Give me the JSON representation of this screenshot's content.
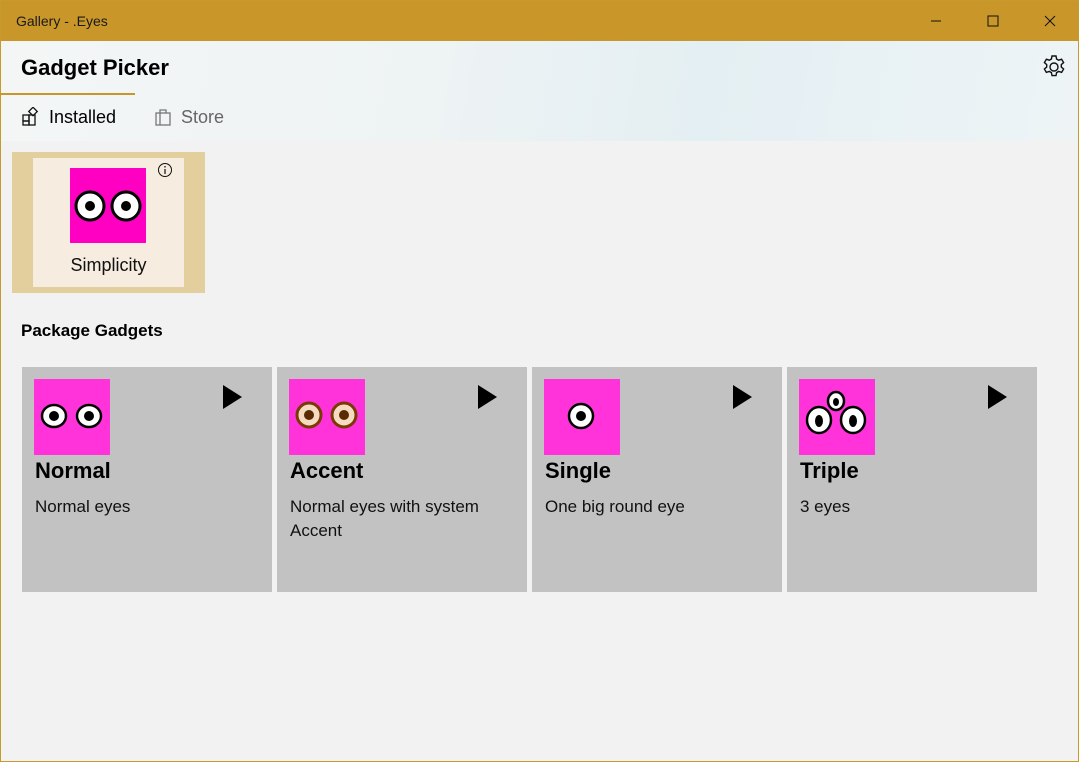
{
  "window": {
    "title": "Gallery - .Eyes",
    "accent_color": "#c9962a"
  },
  "header": {
    "title": "Gadget Picker",
    "settings_icon": "gear-icon",
    "tabs": [
      {
        "label": "Installed",
        "icon": "installed-icon",
        "selected": true
      },
      {
        "label": "Store",
        "icon": "store-bag-icon",
        "selected": false
      }
    ]
  },
  "installed": {
    "items": [
      {
        "label": "Simplicity",
        "thumb_color": "#ff00c3"
      }
    ]
  },
  "package": {
    "section_title": "Package Gadgets",
    "gadgets": [
      {
        "name": "Normal",
        "description": "Normal eyes",
        "thumb_color": "#ff33d9"
      },
      {
        "name": "Accent",
        "description": "Normal eyes with system Accent",
        "thumb_color": "#ff33d9"
      },
      {
        "name": "Single",
        "description": "One big round eye",
        "thumb_color": "#ff33d9"
      },
      {
        "name": "Triple",
        "description": "3 eyes",
        "thumb_color": "#ff33d9"
      }
    ]
  }
}
